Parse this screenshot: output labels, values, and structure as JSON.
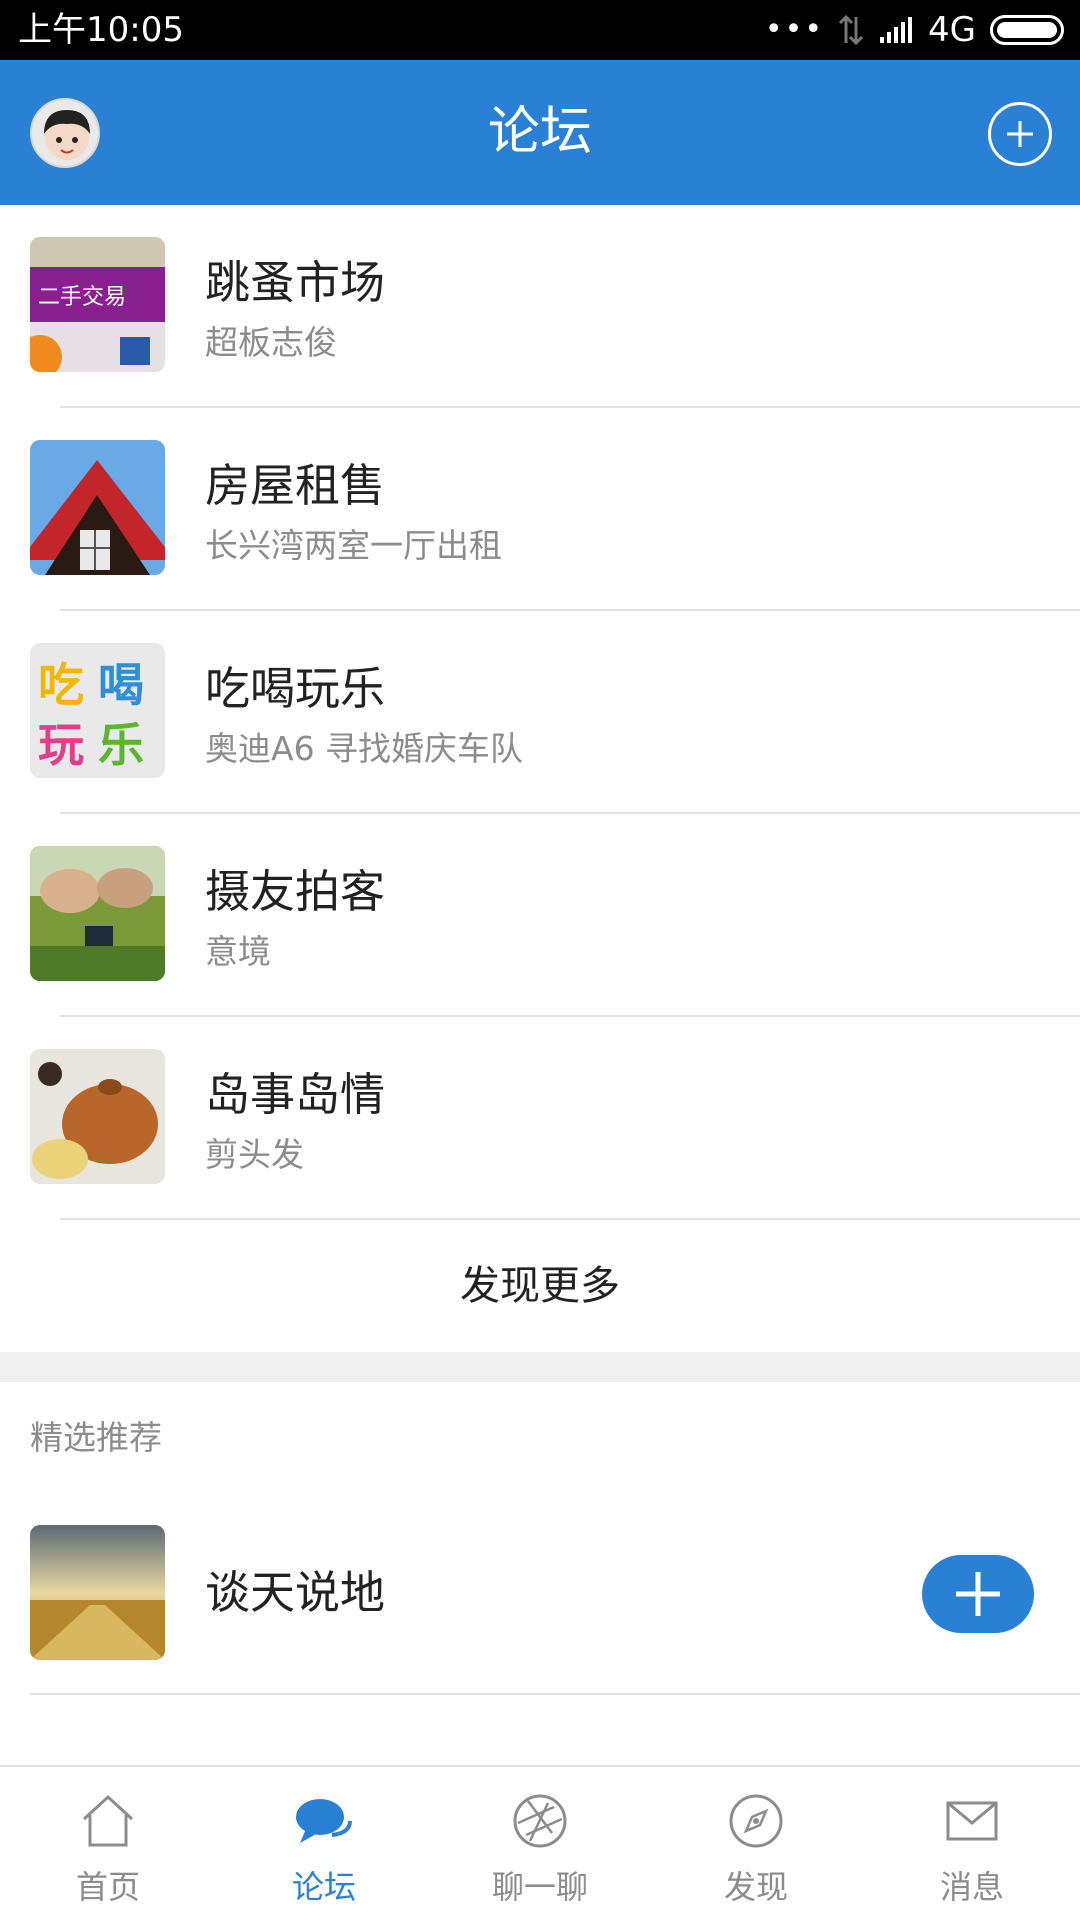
{
  "status_bar": {
    "time": "上午10:05",
    "dots": "•••",
    "network": "4G"
  },
  "app_bar": {
    "title": "论坛"
  },
  "forums": [
    {
      "title": "跳蚤市场",
      "subtitle": "超板志俊",
      "thumb_icon": "secondhand-trade-image"
    },
    {
      "title": "房屋租售",
      "subtitle": "长兴湾两室一厅出租",
      "thumb_icon": "house-image"
    },
    {
      "title": "吃喝玩乐",
      "subtitle": "奥迪A6 寻找婚庆车队",
      "thumb_icon": "food-fun-image"
    },
    {
      "title": "摄友拍客",
      "subtitle": "意境",
      "thumb_icon": "photographers-image"
    },
    {
      "title": "岛事岛情",
      "subtitle": "剪头发",
      "thumb_icon": "teapot-image"
    }
  ],
  "more_label": "发现更多",
  "section_label": "精选推荐",
  "featured": {
    "title": "谈天说地",
    "thumb_icon": "field-landscape-image"
  },
  "bottom_nav": [
    {
      "label": "首页",
      "icon": "home-icon",
      "active": false
    },
    {
      "label": "论坛",
      "icon": "chat-bubble-icon",
      "active": true
    },
    {
      "label": "聊一聊",
      "icon": "aperture-icon",
      "active": false
    },
    {
      "label": "发现",
      "icon": "compass-icon",
      "active": false
    },
    {
      "label": "消息",
      "icon": "mail-icon",
      "active": false
    }
  ],
  "colors": {
    "primary": "#2a80d4",
    "text": "#222222",
    "secondary_text": "#8c8c8c"
  }
}
